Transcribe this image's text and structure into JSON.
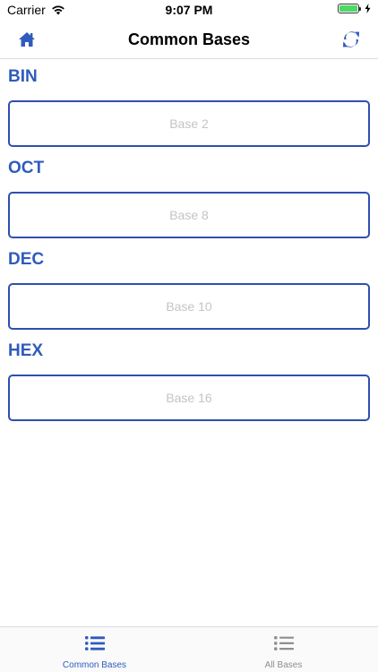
{
  "status_bar": {
    "carrier": "Carrier",
    "time": "9:07 PM"
  },
  "nav": {
    "title": "Common Bases",
    "left_icon": "home-icon",
    "right_icon": "swap-icon"
  },
  "fields": [
    {
      "label": "BIN",
      "placeholder": "Base 2",
      "value": ""
    },
    {
      "label": "OCT",
      "placeholder": "Base 8",
      "value": ""
    },
    {
      "label": "DEC",
      "placeholder": "Base 10",
      "value": ""
    },
    {
      "label": "HEX",
      "placeholder": "Base 16",
      "value": ""
    }
  ],
  "tabs": [
    {
      "label": "Common Bases",
      "icon": "list-icon",
      "active": true
    },
    {
      "label": "All Bases",
      "icon": "list-icon",
      "active": false
    }
  ],
  "colors": {
    "accent": "#2f5bbd",
    "field_border": "#2f4fae",
    "placeholder": "#c4c4c4",
    "inactive_tab": "#8e8e93",
    "battery": "#4cd964"
  }
}
